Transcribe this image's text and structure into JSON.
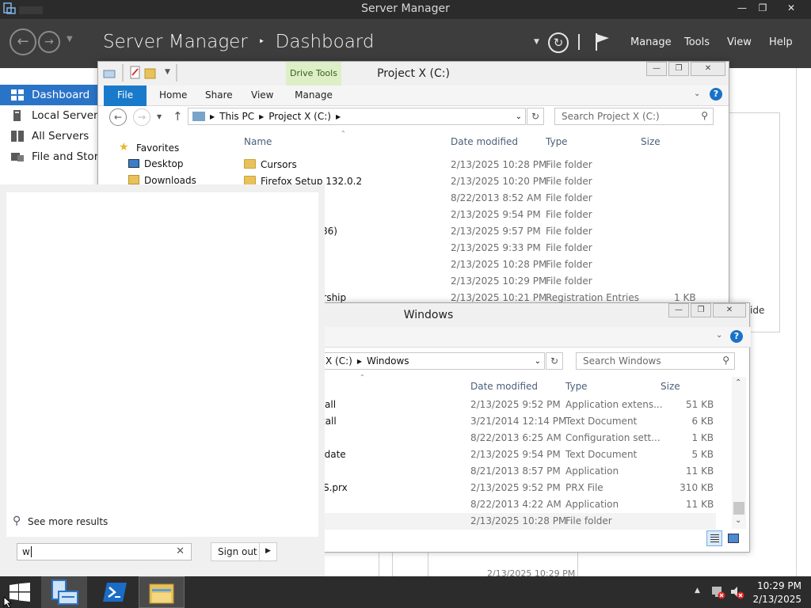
{
  "server_manager": {
    "window_title": "Server Manager",
    "header_title": "Server Manager",
    "breadcrumb_sep": "‣",
    "header_page": "Dashboard",
    "menu": [
      "Manage",
      "Tools",
      "View",
      "Help"
    ],
    "sidebar": [
      {
        "label": "Dashboard",
        "selected": true
      },
      {
        "label": "Local Server",
        "selected": false
      },
      {
        "label": "All Servers",
        "selected": false
      },
      {
        "label": "File and Stora",
        "selected": false
      }
    ],
    "right_fragment": "ide",
    "bottom_fragment": "2/13/2025 10:29 PM"
  },
  "explorer_project": {
    "title": "Project X (C:)",
    "context_tab": "Drive Tools",
    "tabs": [
      "File",
      "Home",
      "Share",
      "View",
      "Manage"
    ],
    "address": [
      "This PC",
      "Project X (C:)"
    ],
    "search_placeholder": "Search Project X (C:)",
    "nav": {
      "favorites": "Favorites",
      "desktop": "Desktop",
      "downloads": "Downloads"
    },
    "columns": {
      "name": "Name",
      "date": "Date modified",
      "type": "Type",
      "size": "Size"
    },
    "rows": [
      {
        "name": "Cursors",
        "date": "2/13/2025 10:28 PM",
        "type": "File folder",
        "size": ""
      },
      {
        "name": "Firefox Setup 132.0.2",
        "date": "2/13/2025 10:20 PM",
        "type": "File folder",
        "size": ""
      },
      {
        "name": "",
        "date": "8/22/2013 8:52 AM",
        "type": "File folder",
        "size": ""
      },
      {
        "name": "",
        "date": "2/13/2025 9:54 PM",
        "type": "File folder",
        "size": ""
      },
      {
        "name": "86)",
        "date": "2/13/2025 9:57 PM",
        "type": "File folder",
        "size": ""
      },
      {
        "name": "",
        "date": "2/13/2025 9:33 PM",
        "type": "File folder",
        "size": ""
      },
      {
        "name": "",
        "date": "2/13/2025 10:28 PM",
        "type": "File folder",
        "size": ""
      },
      {
        "name": "",
        "date": "2/13/2025 10:29 PM",
        "type": "File folder",
        "size": ""
      },
      {
        "name": "ership",
        "date": "2/13/2025 10:21 PM",
        "type": "Registration Entries",
        "size": "1 KB"
      }
    ]
  },
  "explorer_windows": {
    "title": "Windows",
    "address": [
      "X (C:)",
      "Windows"
    ],
    "search_placeholder": "Search Windows",
    "columns": {
      "date": "Date modified",
      "type": "Type",
      "size": "Size"
    },
    "rows": [
      {
        "name": "all",
        "date": "2/13/2025 9:52 PM",
        "type": "Application extens...",
        "size": "51 KB"
      },
      {
        "name": "tall",
        "date": "3/21/2014 12:14 PM",
        "type": "Text Document",
        "size": "6 KB"
      },
      {
        "name": "",
        "date": "8/22/2013 6:25 AM",
        "type": "Configuration sett...",
        "size": "1 KB"
      },
      {
        "name": "pdate",
        "date": "2/13/2025 9:54 PM",
        "type": "Text Document",
        "size": "5 KB"
      },
      {
        "name": "",
        "date": "8/21/2013 8:57 PM",
        "type": "Application",
        "size": "11 KB"
      },
      {
        "name": "S.prx",
        "date": "2/13/2025 9:52 PM",
        "type": "PRX File",
        "size": "310 KB"
      },
      {
        "name": "",
        "date": "8/22/2013 4:22 AM",
        "type": "Application",
        "size": "11 KB"
      },
      {
        "name": "",
        "date": "2/13/2025 10:28 PM",
        "type": "File folder",
        "size": ""
      }
    ]
  },
  "start": {
    "see_more": "See more results",
    "search_value": "w",
    "sign_out": "Sign out"
  },
  "taskbar": {
    "time": "10:29 PM",
    "date": "2/13/2025"
  }
}
